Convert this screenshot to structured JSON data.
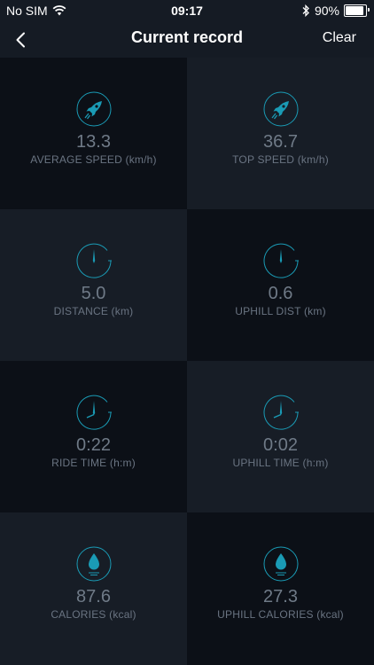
{
  "status": {
    "carrier": "No SIM",
    "time": "09:17",
    "battery": "90%",
    "battery_level": 0.9
  },
  "nav": {
    "title": "Current record",
    "clear_label": "Clear"
  },
  "colors": {
    "accent": "#1a9bb5",
    "tile_dark": "#0c1017",
    "tile_light": "#171d26",
    "value_text": "#6f7a87"
  },
  "tiles": [
    {
      "value": "13.3",
      "label": "AVERAGE SPEED (km/h)",
      "icon": "rocket-icon"
    },
    {
      "value": "36.7",
      "label": "TOP SPEED (km/h)",
      "icon": "rocket-icon"
    },
    {
      "value": "5.0",
      "label": "DISTANCE (km)",
      "icon": "compass-icon"
    },
    {
      "value": "0.6",
      "label": "UPHILL DIST (km)",
      "icon": "compass-icon"
    },
    {
      "value": "0:22",
      "label": "RIDE TIME (h:m)",
      "icon": "clock-icon"
    },
    {
      "value": "0:02",
      "label": "UPHILL TIME (h:m)",
      "icon": "clock-icon"
    },
    {
      "value": "87.6",
      "label": "CALORIES (kcal)",
      "icon": "drop-icon"
    },
    {
      "value": "27.3",
      "label": "UPHILL CALORIES (kcal)",
      "icon": "drop-icon"
    }
  ]
}
